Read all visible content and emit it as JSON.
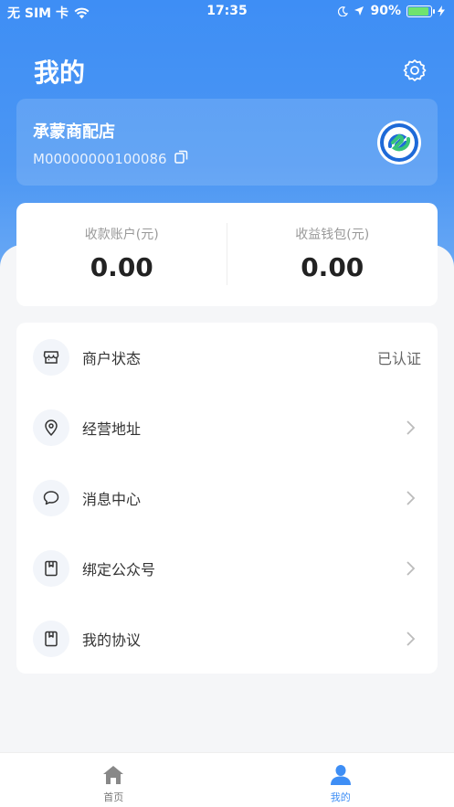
{
  "status_bar": {
    "carrier": "无 SIM 卡",
    "time": "17:35",
    "battery": "90%",
    "battery_level": 0.9
  },
  "header": {
    "title": "我的"
  },
  "merchant": {
    "name": "承蒙商配店",
    "id": "M00000000100086"
  },
  "balances": [
    {
      "label": "收款账户(元)",
      "value": "0.00"
    },
    {
      "label": "收益钱包(元)",
      "value": "0.00"
    }
  ],
  "menu": [
    {
      "label": "商户状态",
      "right": "已认证",
      "icon": "store-icon"
    },
    {
      "label": "经营地址",
      "right": "",
      "icon": "location-pin-icon"
    },
    {
      "label": "消息中心",
      "right": "",
      "icon": "chat-bubble-icon"
    },
    {
      "label": "绑定公众号",
      "right": "",
      "icon": "bookmark-icon"
    },
    {
      "label": "我的协议",
      "right": "",
      "icon": "bookmark-icon"
    }
  ],
  "tabs": [
    {
      "label": "首页",
      "icon": "home-icon",
      "active": false
    },
    {
      "label": "我的",
      "icon": "user-icon",
      "active": true
    }
  ],
  "colors": {
    "primary": "#3e8ef5",
    "background": "#f5f6f8"
  }
}
